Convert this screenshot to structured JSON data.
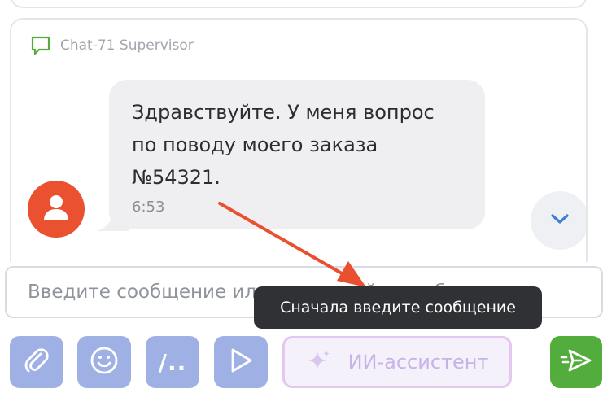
{
  "chat": {
    "header_title": "Chat-71 Supervisor",
    "header_icon": "chat-bubble-icon",
    "message": {
      "text": "Здравствуйте. У меня вопрос\nпо поводу моего заказа\n№54321.",
      "time": "6:53",
      "avatar_icon": "user-icon",
      "avatar_color": "#ea5131"
    },
    "scroll_button_icon": "chevron-down-icon"
  },
  "composer": {
    "placeholder": "Введите сообщение или используйте шаблонов",
    "tooltip": "Сначала введите сообщение"
  },
  "toolbar": {
    "attach_icon": "paperclip-icon",
    "emoji_icon": "smile-icon",
    "templates_label": "/..",
    "play_icon": "play-icon",
    "ai_label": "ИИ-ассистент",
    "ai_icon": "sparkle-icon",
    "send_icon": "send-icon"
  },
  "colors": {
    "accent_blue": "#9fb0e4",
    "send_green": "#52ad3c",
    "annotation_red": "#e8502f",
    "tooltip_bg": "#2f3134"
  }
}
